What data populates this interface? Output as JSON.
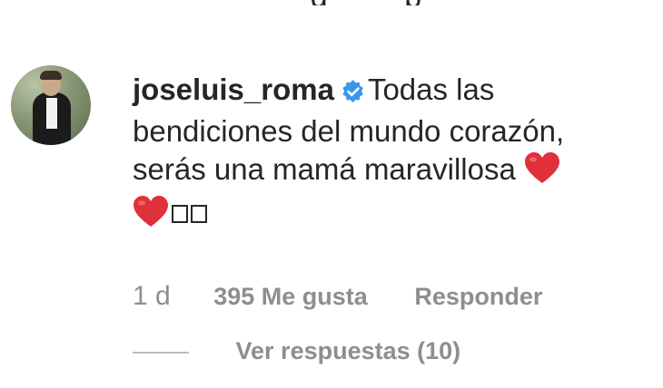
{
  "comment": {
    "username": "joseluis_roma",
    "verified": true,
    "text_part1": "Todas las bendiciones del mundo corazón, serás una mamá maravillosa",
    "emoji": [
      "red-heart-icon",
      "red-heart-icon",
      "missing-glyph",
      "missing-glyph"
    ],
    "time": "1 d",
    "likes": "395 Me gusta",
    "reply_label": "Responder",
    "view_replies": "Ver respuestas (10)"
  },
  "colors": {
    "text": "#262626",
    "secondary": "#8e8e8e",
    "verified": "#3897f0",
    "heart": "#e0303a"
  }
}
